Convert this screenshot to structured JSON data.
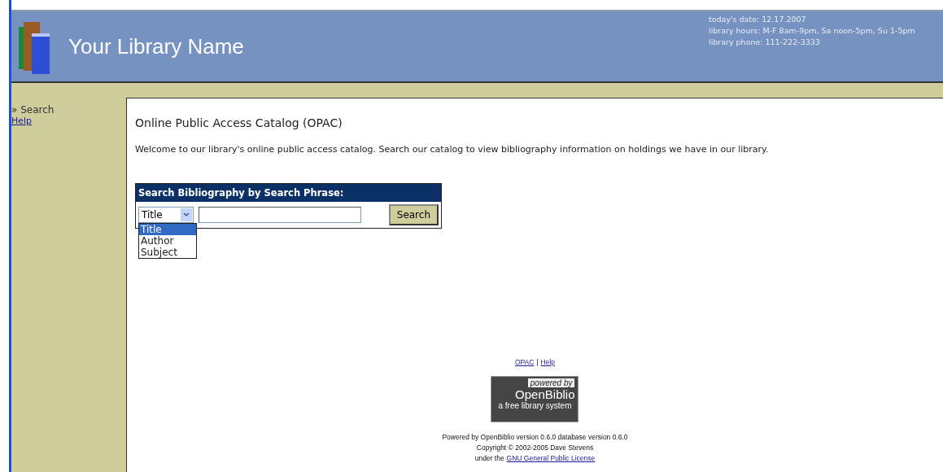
{
  "header": {
    "library_name": "Your Library Name",
    "info": [
      "today's date:  12.17.2007",
      "library hours:  M-F 8am-9pm, Sa noon-5pm, Su 1-5pm",
      "library phone: 111-222-3333"
    ]
  },
  "sidebar": {
    "items": [
      {
        "label": "» Search",
        "kind": "current"
      },
      {
        "label": "Help",
        "kind": "link"
      }
    ]
  },
  "content": {
    "title": "Online Public Access Catalog (OPAC)",
    "intro": "Welcome to our library's online public access catalog. Search our catalog to view bibliography information on holdings we have in our library.",
    "search": {
      "heading": "Search Bibliography by Search Phrase:",
      "select_value": "Title",
      "options": [
        {
          "label": "Title",
          "selected": true
        },
        {
          "label": "Author",
          "selected": false
        },
        {
          "label": "Subject",
          "selected": false
        }
      ],
      "button": "Search"
    },
    "footer_links": [
      "OPAC",
      "Help"
    ],
    "footer_separator": "|",
    "badge": {
      "top": "powered by",
      "name": "OpenBiblio",
      "tagline": "a free library system"
    },
    "credits": [
      "Powered by OpenBiblio version 0.6.0 database version 0.6.0",
      "Copyright © 2002-2005 Dave Stevens"
    ],
    "license": {
      "prefix": "under the",
      "link": "GNU General Public License"
    }
  }
}
